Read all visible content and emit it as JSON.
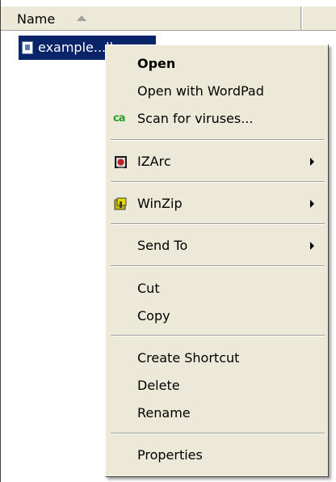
{
  "header": {
    "name_column": "Name"
  },
  "file": {
    "name": "example...lk"
  },
  "menu": {
    "open": "Open",
    "open_with": "Open with WordPad",
    "scan_icon_text": "ca",
    "scan": "Scan for viruses...",
    "izarc": "IZArc",
    "winzip": "WinZip",
    "send_to": "Send To",
    "cut": "Cut",
    "copy": "Copy",
    "create_shortcut": "Create Shortcut",
    "delete": "Delete",
    "rename": "Rename",
    "properties": "Properties"
  },
  "colors": {
    "menu_bg": "#ece9d8",
    "selection": "#0a246a",
    "scan_icon": "#2aa02a"
  },
  "icons": {
    "izarc": "izarc-icon",
    "winzip": "winzip-icon",
    "file": "document-icon"
  }
}
